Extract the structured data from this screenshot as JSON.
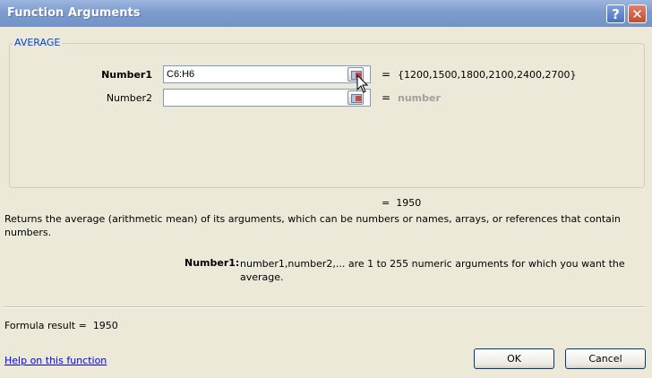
{
  "window": {
    "title": "Function Arguments",
    "help_glyph": "?",
    "close_glyph": "✕"
  },
  "function": {
    "name": "AVERAGE"
  },
  "args": [
    {
      "label": "Number1",
      "value": "C6:H6",
      "result": "{1200,1500,1800,2100,2400,2700}"
    },
    {
      "label": "Number2",
      "value": "",
      "result": "number"
    }
  ],
  "equals": "=",
  "function_result": "1950",
  "description": "Returns the average (arithmetic mean) of its arguments, which can be numbers or names, arrays, or references that contain numbers.",
  "arg_help": {
    "label": "Number1:",
    "text": "number1,number2,... are 1 to 255 numeric arguments for which you want the average."
  },
  "formula_result": {
    "label": "Formula result =",
    "value": "1950"
  },
  "help_link": "Help on this function",
  "buttons": {
    "ok": "OK",
    "cancel": "Cancel"
  },
  "icons": {
    "ref": "collapse-dialog-icon",
    "cursor": "mouse-pointer-icon"
  }
}
